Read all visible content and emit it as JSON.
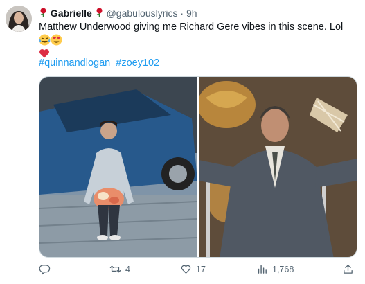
{
  "tweet": {
    "display_name": "Gabrielle",
    "handle": "@gabulouslyrics",
    "separator": "·",
    "time": "9h",
    "text": "Matthew Underwood giving me Richard Gere vibes in this scene. Lol",
    "hashtags": [
      "#quinnandlogan",
      "#zoey102"
    ]
  },
  "actions": {
    "replies": "",
    "retweets": "4",
    "likes": "17",
    "views": "1,768"
  },
  "colors": {
    "link": "#1d9bf0",
    "muted": "#536471",
    "rose": "#d0112b"
  },
  "icons": [
    "rose-icon",
    "laughing-emoji-icon",
    "heart-eyes-emoji-icon",
    "red-heart-emoji-icon",
    "reply-icon",
    "retweet-icon",
    "like-icon",
    "views-icon",
    "share-icon"
  ]
}
